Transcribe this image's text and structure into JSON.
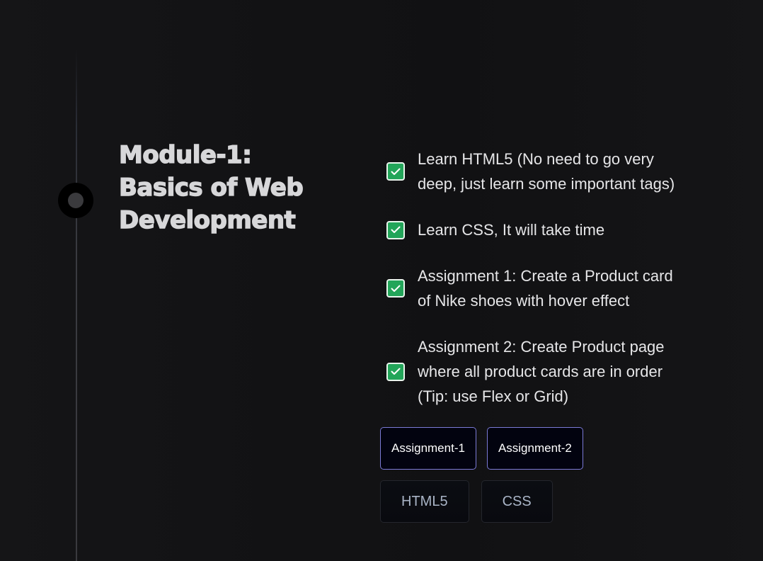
{
  "module": {
    "title_main": "Module-1:",
    "title_sub": "Basics of Web Development"
  },
  "tasks": [
    {
      "text": "Learn HTML5 (No need to go very deep, just learn some important tags)",
      "checked": true
    },
    {
      "text": "Learn CSS, It will take time",
      "checked": true
    },
    {
      "text": "Assignment 1: Create a Product card of Nike shoes with hover effect",
      "checked": true
    },
    {
      "text": "Assignment 2: Create Product page where all product cards are in order (Tip: use Flex or Grid)",
      "checked": true
    }
  ],
  "assignment_buttons": [
    "Assignment-1",
    "Assignment-2"
  ],
  "tags": [
    "HTML5",
    "CSS"
  ],
  "icons": {
    "check": "check-icon",
    "timeline": "timeline-dot-icon"
  },
  "colors": {
    "check_fill": "#22a559",
    "assignment_border": "#7b7ad6",
    "tag_text": "#a9b4c6"
  }
}
